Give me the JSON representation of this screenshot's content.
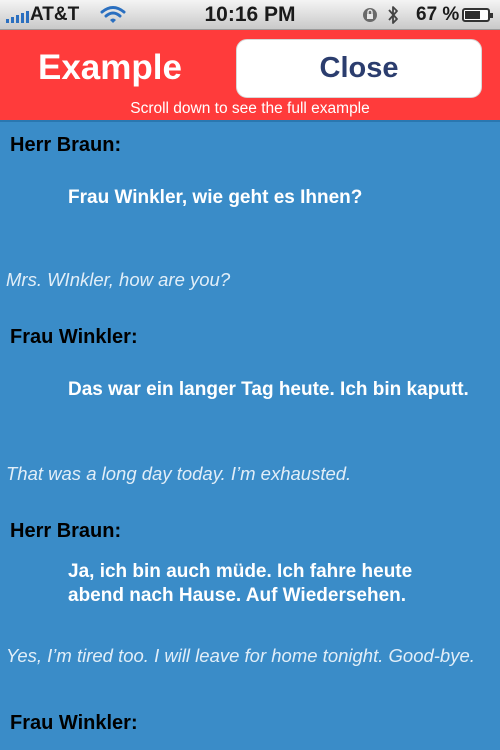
{
  "status_bar": {
    "carrier": "AT&T",
    "time": "10:16 PM",
    "battery": "67 %",
    "battery_level": 0.67,
    "icons": [
      "signal-bars-icon",
      "wifi-icon",
      "lock-rotation-icon",
      "bluetooth-icon",
      "battery-icon"
    ]
  },
  "header": {
    "title": "Example",
    "close_label": "Close",
    "hint": "Scroll down to see the full example"
  },
  "dialog": [
    {
      "speaker": "Herr Braun:",
      "german": "Frau Winkler, wie geht es Ihnen?",
      "english": "Mrs. WInkler, how are you?"
    },
    {
      "speaker": "Frau Winkler:",
      "german": "Das war ein langer Tag heute. Ich bin kaputt.",
      "english": "That was a long day today. I’m exhausted."
    },
    {
      "speaker": "Herr Braun:",
      "german": "Ja, ich bin auch müde. Ich fahre heute abend nach Hause. Auf Wiedersehen.",
      "english": "Yes, I’m tired too. I will leave for home tonight. Good-bye."
    },
    {
      "speaker": "Frau Winkler:"
    }
  ],
  "colors": {
    "header_bg": "#ff3b3b",
    "content_bg": "#3a8cc8",
    "close_text": "#2b3d6e"
  }
}
